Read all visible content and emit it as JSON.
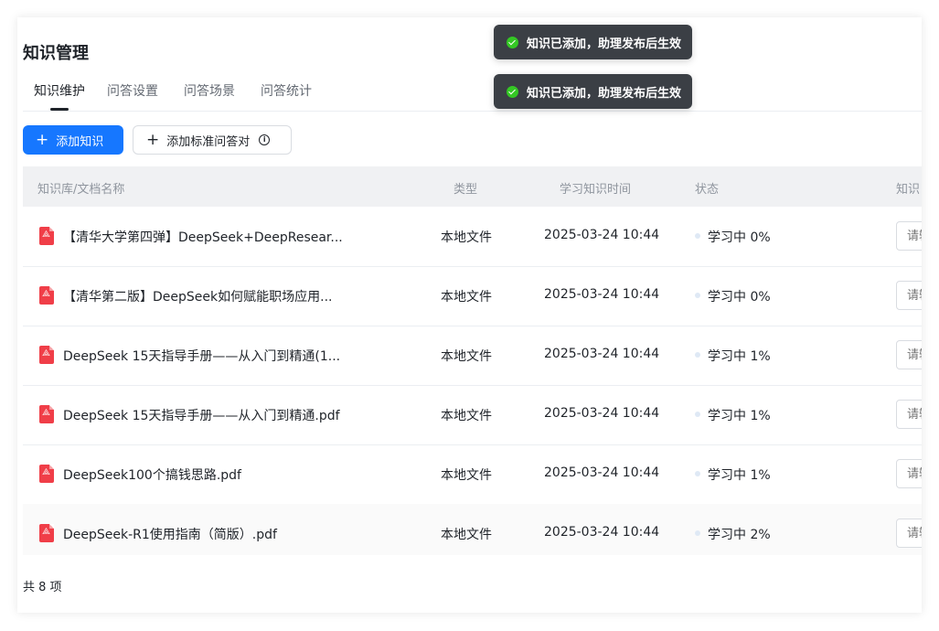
{
  "page": {
    "title": "知识管理",
    "tabs": [
      {
        "label": "知识维护",
        "active": true
      },
      {
        "label": "问答设置",
        "active": false
      },
      {
        "label": "问答场景",
        "active": false
      },
      {
        "label": "问答统计",
        "active": false
      }
    ]
  },
  "toolbar": {
    "add_knowledge_label": "添加知识",
    "add_qa_label": "添加标准问答对",
    "plus_icon": "plus-icon",
    "info_icon": "info-circle-icon"
  },
  "table": {
    "columns": {
      "name": "知识库/文档名称",
      "type": "类型",
      "time": "学习知识时间",
      "status": "状态",
      "keyword": "知识"
    },
    "rows": [
      {
        "name": "【清华大学第四弹】DeepSeek+DeepResear...",
        "type": "本地文件",
        "time": "2025-03-24 10:44",
        "status": "学习中 0%",
        "placeholder": "请输"
      },
      {
        "name": "【清华第二版】DeepSeek如何赋能职场应用...",
        "type": "本地文件",
        "time": "2025-03-24 10:44",
        "status": "学习中 0%",
        "placeholder": "请输"
      },
      {
        "name": "DeepSeek 15天指导手册——从入门到精通(1...",
        "type": "本地文件",
        "time": "2025-03-24 10:44",
        "status": "学习中 1%",
        "placeholder": "请输"
      },
      {
        "name": "DeepSeek 15天指导手册——从入门到精通.pdf",
        "type": "本地文件",
        "time": "2025-03-24 10:44",
        "status": "学习中 1%",
        "placeholder": "请输"
      },
      {
        "name": "DeepSeek100个搞钱思路.pdf",
        "type": "本地文件",
        "time": "2025-03-24 10:44",
        "status": "学习中 1%",
        "placeholder": "请输"
      },
      {
        "name": "DeepSeek-R1使用指南（简版）.pdf",
        "type": "本地文件",
        "time": "2025-03-24 10:44",
        "status": "学习中 2%",
        "placeholder": "请输"
      }
    ]
  },
  "footer": {
    "total": "共 8 项"
  },
  "toasts": [
    {
      "message": "知识已添加，助理发布后生效"
    },
    {
      "message": "知识已添加，助理发布后生效"
    }
  ],
  "colors": {
    "primary": "#1677ff",
    "toast_bg": "#3b3f45",
    "success": "#34c724",
    "pdf": "#f03e48",
    "header_bg": "#f0f1f3"
  }
}
